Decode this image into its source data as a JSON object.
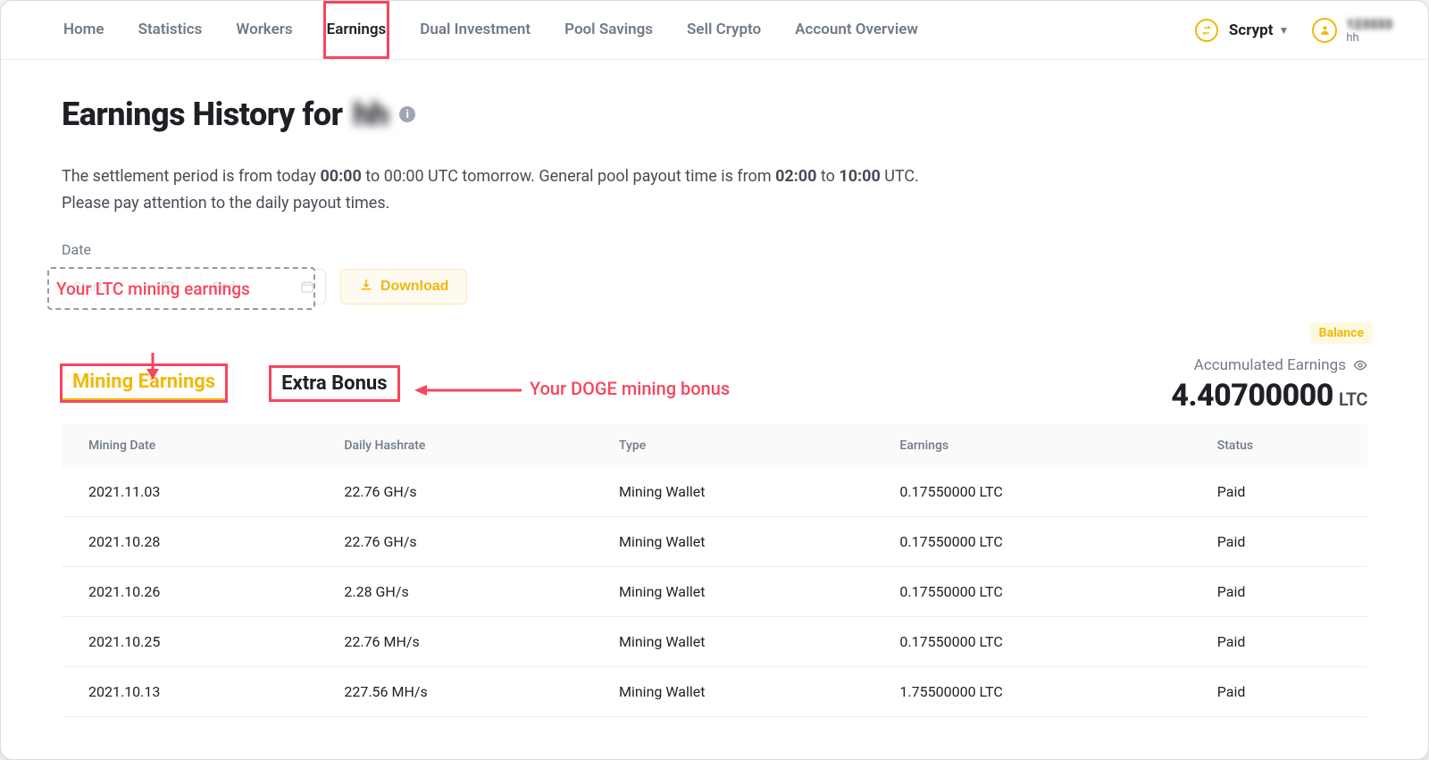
{
  "nav": {
    "items": [
      {
        "label": "Home"
      },
      {
        "label": "Statistics"
      },
      {
        "label": "Workers"
      },
      {
        "label": "Earnings",
        "active": true,
        "highlight": true
      },
      {
        "label": "Dual Investment"
      },
      {
        "label": "Pool Savings"
      },
      {
        "label": "Sell Crypto"
      },
      {
        "label": "Account Overview"
      }
    ],
    "algorithm": "Scrypt",
    "account_masked": "123333",
    "account_sub": "hh"
  },
  "page": {
    "title_prefix": "Earnings History for ",
    "title_masked": "hh",
    "settlement_html": "The settlement period is from today 00:00 to 00:00 UTC tomorrow. General pool payout time is from 02:00 to 10:00 UTC. Please pay attention to the daily payout times.",
    "settlement_bold": [
      "00:00",
      "00:00",
      "02:00",
      "10:00"
    ]
  },
  "date": {
    "label": "Date",
    "start_placeholder": "Start",
    "end_placeholder": "End",
    "download_label": "Download"
  },
  "annotations": {
    "ltc_callout": "Your LTC mining earnings",
    "doge_callout": "Your DOGE mining bonus"
  },
  "balance_pill": "Balance",
  "accumulated": {
    "label": "Accumulated Earnings",
    "value": "4.40700000",
    "unit": "LTC"
  },
  "tabs": {
    "mining": "Mining Earnings",
    "bonus": "Extra Bonus"
  },
  "table": {
    "columns": [
      "Mining Date",
      "Daily Hashrate",
      "Type",
      "Earnings",
      "Status"
    ],
    "rows": [
      {
        "date": "2021.11.03",
        "hash": "22.76 GH/s",
        "type": "Mining Wallet",
        "earn": "0.17550000 LTC",
        "status": "Paid"
      },
      {
        "date": "2021.10.28",
        "hash": "22.76 GH/s",
        "type": "Mining Wallet",
        "earn": "0.17550000 LTC",
        "status": "Paid"
      },
      {
        "date": "2021.10.26",
        "hash": "2.28 GH/s",
        "type": "Mining Wallet",
        "earn": "0.17550000 LTC",
        "status": "Paid"
      },
      {
        "date": "2021.10.25",
        "hash": "22.76 MH/s",
        "type": "Mining Wallet",
        "earn": "0.17550000 LTC",
        "status": "Paid"
      },
      {
        "date": "2021.10.13",
        "hash": "227.56 MH/s",
        "type": "Mining Wallet",
        "earn": "1.75500000 LTC",
        "status": "Paid"
      }
    ]
  }
}
